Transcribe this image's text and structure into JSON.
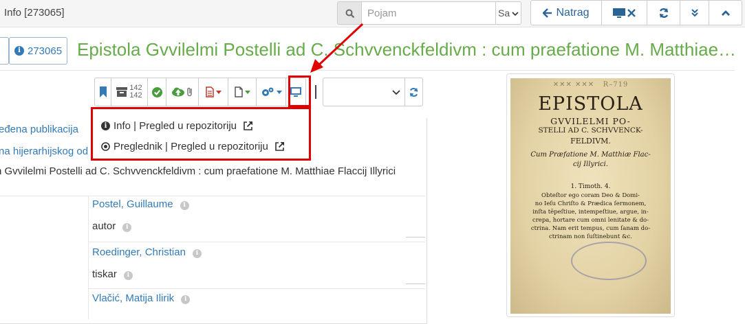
{
  "topbar": {
    "window_title": "Info [273065]",
    "search_placeholder": "Pojam",
    "search_scope": "Sa",
    "back_label": "Natrag",
    "icons": [
      "search-icon",
      "arrow-left-icon",
      "monitor-close-icon",
      "refresh-icon",
      "double-chevron-down-icon",
      "chevron-up-icon"
    ]
  },
  "record": {
    "id": "273065",
    "title": "Epistola Gvvilelmi Postelli ad C. Schvvenckfeldivm : cum praefatione M. Matthiae Flaccij Illyrici"
  },
  "toolbar": {
    "counter_top": "142",
    "counter_bottom": "142",
    "icons": [
      "bookmark-icon",
      "archive-icon",
      "check-circle-icon",
      "cloud-upload-icon",
      "paperclip-icon",
      "document-icon",
      "file-icon",
      "cogs-icon",
      "monitor-icon",
      "refresh-icon"
    ]
  },
  "content": {
    "row1": "eđena publikacija",
    "row2": "na hijerarhijskog od",
    "row3": "n Gvvilelmi Postelli ad C. Schvvenckfeldivm : cum praefatione M. Matthiae Flaccij Illyrici",
    "persons": [
      {
        "name": "Postel, Guillaume",
        "role": "autor"
      },
      {
        "name": "Roedinger, Christian",
        "role": "tiskar"
      },
      {
        "name": "Vlačić, Matija Ilirik",
        "role": ""
      }
    ]
  },
  "dropdown": {
    "items": [
      {
        "label": "Info | Pregled u repozitoriju",
        "icon": "info-circle-icon"
      },
      {
        "label": "Preglednik | Pregled u repozitoriju",
        "icon": "dot-circle-icon"
      }
    ]
  },
  "cover": {
    "lines": [
      "EPISTOLA",
      "GVVILELMI PO-",
      "STELLI AD C. SCHVVENCK-",
      "FELDIVM.",
      "Cum Præfatione M. Matthiæ Flac-",
      "cij Illyrici.",
      "1. Timoth. 4.",
      "Obteſtor ego coram Deo & Domi-",
      "no Ieſu Chriſto & Prædica ſermonem,",
      "inſta tēpeſtiue, intempeſtiue, argue, in-",
      "crepa, hortare cum omni lenitate & do-",
      "ctrina. Nam erit tempus, cum ſanam do-",
      "ctrinam non ſuſtinebunt &c."
    ]
  },
  "colors": {
    "accent": "#337ab7",
    "title_green": "#67ab4a",
    "highlight_red": "#e00000"
  }
}
